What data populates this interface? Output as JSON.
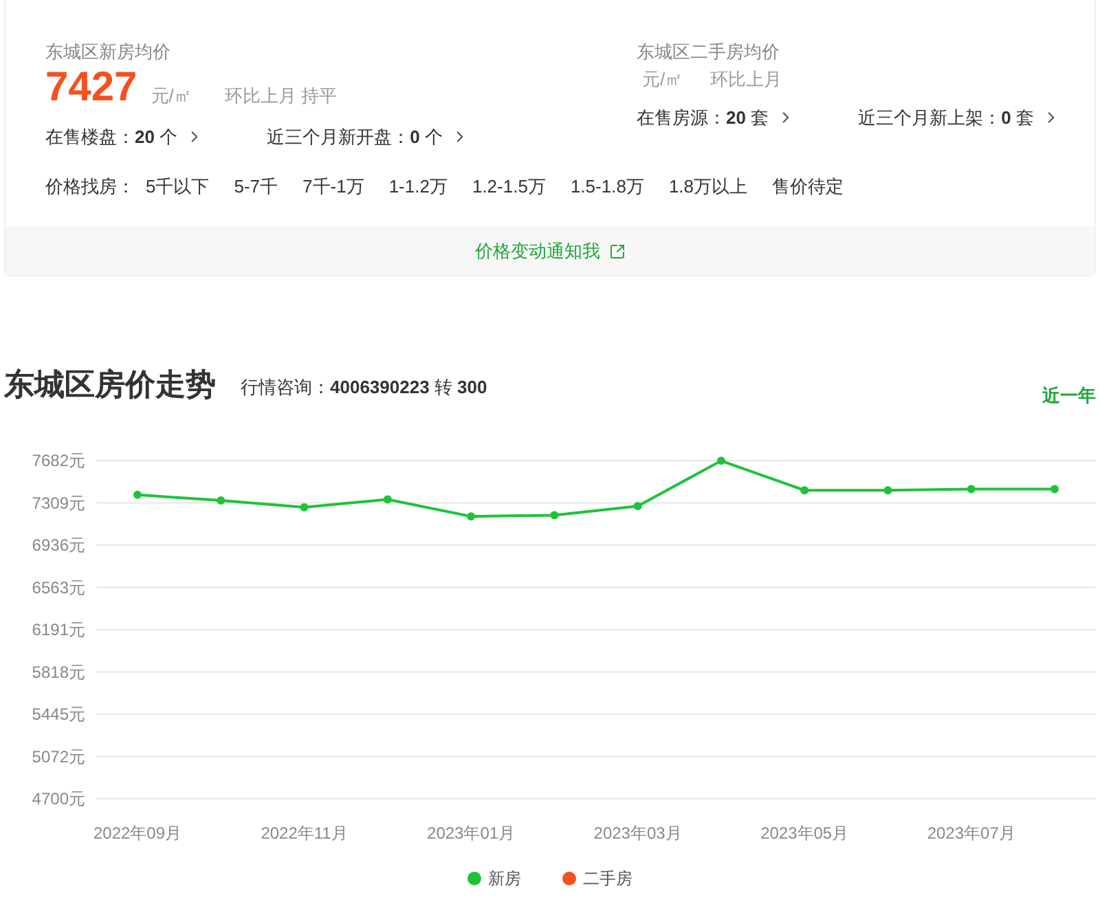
{
  "new_house": {
    "title": "东城区新房均价",
    "price": "7427",
    "unit": "元/㎡",
    "change_label": "环比上月",
    "change": "持平",
    "links": [
      "在售楼盘：**20** 个",
      "近三个月新开盘：**0** 个"
    ]
  },
  "second_hand": {
    "title": "东城区二手房均价",
    "unit": "元/㎡",
    "change_label": "环比上月",
    "links": [
      "在售房源：**20** 套",
      "近三个月新上架：**0** 套"
    ]
  },
  "price_filters": {
    "label": "价格找房：",
    "options": [
      "5千以下",
      "5-7千",
      "7千-1万",
      "1-1.2万",
      "1.2-1.5万",
      "1.5-1.8万",
      "1.8万以上",
      "售价待定"
    ]
  },
  "notify": "价格变动通知我",
  "trend": {
    "title": "东城区房价走势",
    "hotline": "行情咨询：**4006390223** 转 **300**",
    "range": "近一年",
    "chart_data": {
      "type": "line",
      "categories": [
        "2022年09月",
        null,
        "2022年11月",
        null,
        "2023年01月",
        null,
        "2023年03月",
        null,
        "2023年05月",
        null,
        "2023年07月",
        null
      ],
      "grid": true,
      "series": [
        {
          "name": "新房",
          "color": "#1ec33b",
          "marker": "circle",
          "values": [
            7380,
            7330,
            7270,
            7340,
            7190,
            7200,
            7280,
            7680,
            7420,
            7420,
            7430,
            7430
          ]
        },
        {
          "name": "二手房",
          "color": "#f4511e",
          "values": [
            null,
            null,
            null,
            null,
            null,
            null,
            null,
            null,
            null,
            null,
            null,
            null
          ]
        }
      ],
      "ylim": [
        4700,
        7682
      ],
      "yticks": [
        {
          "value": 7682,
          "label": "7682元"
        },
        {
          "value": 7309,
          "label": "7309元"
        },
        {
          "value": 6936,
          "label": "6936元"
        },
        {
          "value": 6563,
          "label": "6563元"
        },
        {
          "value": 6191,
          "label": "6191元"
        },
        {
          "value": 5818,
          "label": "5818元"
        },
        {
          "value": 5445,
          "label": "5445元"
        },
        {
          "value": 5072,
          "label": "5072元"
        },
        {
          "value": 4700,
          "label": "4700元"
        }
      ]
    }
  }
}
